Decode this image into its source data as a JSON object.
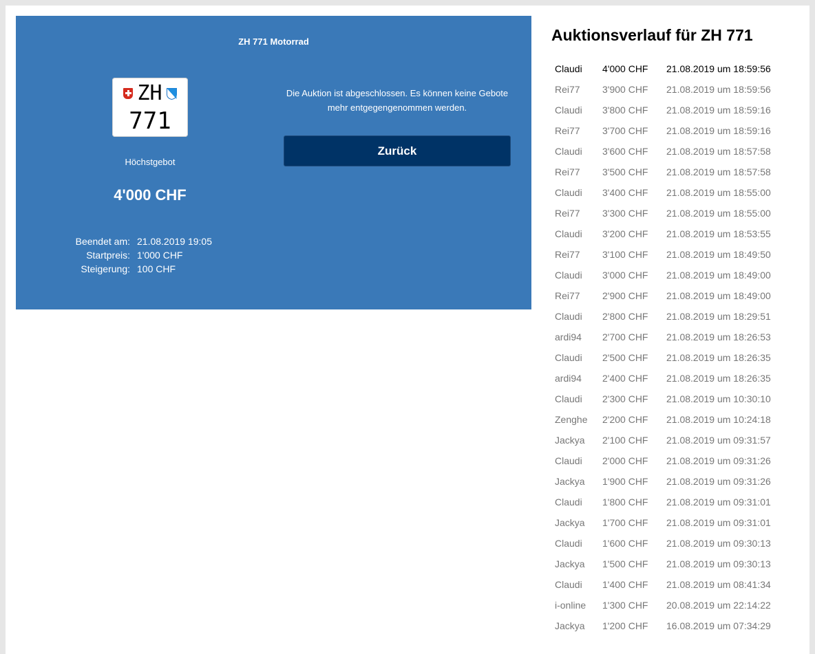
{
  "panel": {
    "title": "ZH 771 Motorrad",
    "plate": {
      "canton": "ZH",
      "number": "771"
    },
    "highest_bid_label": "Höchstgebot",
    "highest_bid_value": "4'000 CHF",
    "info": [
      {
        "label": "Beendet am:",
        "value": "21.08.2019 19:05"
      },
      {
        "label": "Startpreis:",
        "value": "1'000 CHF"
      },
      {
        "label": "Steigerung:",
        "value": "100 CHF"
      }
    ],
    "closed_message": "Die Auktion ist abgeschlossen. Es können keine Gebote mehr entgegengenommen werden.",
    "back_label": "Zurück"
  },
  "history": {
    "title": "Auktionsverlauf für ZH 771",
    "rows": [
      {
        "user": "Claudi",
        "amount": "4'000 CHF",
        "time": "21.08.2019 um 18:59:56"
      },
      {
        "user": "Rei77",
        "amount": "3'900 CHF",
        "time": "21.08.2019 um 18:59:56"
      },
      {
        "user": "Claudi",
        "amount": "3'800 CHF",
        "time": "21.08.2019 um 18:59:16"
      },
      {
        "user": "Rei77",
        "amount": "3'700 CHF",
        "time": "21.08.2019 um 18:59:16"
      },
      {
        "user": "Claudi",
        "amount": "3'600 CHF",
        "time": "21.08.2019 um 18:57:58"
      },
      {
        "user": "Rei77",
        "amount": "3'500 CHF",
        "time": "21.08.2019 um 18:57:58"
      },
      {
        "user": "Claudi",
        "amount": "3'400 CHF",
        "time": "21.08.2019 um 18:55:00"
      },
      {
        "user": "Rei77",
        "amount": "3'300 CHF",
        "time": "21.08.2019 um 18:55:00"
      },
      {
        "user": "Claudi",
        "amount": "3'200 CHF",
        "time": "21.08.2019 um 18:53:55"
      },
      {
        "user": "Rei77",
        "amount": "3'100 CHF",
        "time": "21.08.2019 um 18:49:50"
      },
      {
        "user": "Claudi",
        "amount": "3'000 CHF",
        "time": "21.08.2019 um 18:49:00"
      },
      {
        "user": "Rei77",
        "amount": "2'900 CHF",
        "time": "21.08.2019 um 18:49:00"
      },
      {
        "user": "Claudi",
        "amount": "2'800 CHF",
        "time": "21.08.2019 um 18:29:51"
      },
      {
        "user": "ardi94",
        "amount": "2'700 CHF",
        "time": "21.08.2019 um 18:26:53"
      },
      {
        "user": "Claudi",
        "amount": "2'500 CHF",
        "time": "21.08.2019 um 18:26:35"
      },
      {
        "user": "ardi94",
        "amount": "2'400 CHF",
        "time": "21.08.2019 um 18:26:35"
      },
      {
        "user": "Claudi",
        "amount": "2'300 CHF",
        "time": "21.08.2019 um 10:30:10"
      },
      {
        "user": "Zenghe",
        "amount": "2'200 CHF",
        "time": "21.08.2019 um 10:24:18"
      },
      {
        "user": "Jackya",
        "amount": "2'100 CHF",
        "time": "21.08.2019 um 09:31:57"
      },
      {
        "user": "Claudi",
        "amount": "2'000 CHF",
        "time": "21.08.2019 um 09:31:26"
      },
      {
        "user": "Jackya",
        "amount": "1'900 CHF",
        "time": "21.08.2019 um 09:31:26"
      },
      {
        "user": "Claudi",
        "amount": "1'800 CHF",
        "time": "21.08.2019 um 09:31:01"
      },
      {
        "user": "Jackya",
        "amount": "1'700 CHF",
        "time": "21.08.2019 um 09:31:01"
      },
      {
        "user": "Claudi",
        "amount": "1'600 CHF",
        "time": "21.08.2019 um 09:30:13"
      },
      {
        "user": "Jackya",
        "amount": "1'500 CHF",
        "time": "21.08.2019 um 09:30:13"
      },
      {
        "user": "Claudi",
        "amount": "1'400 CHF",
        "time": "21.08.2019 um 08:41:34"
      },
      {
        "user": "i-online",
        "amount": "1'300 CHF",
        "time": "20.08.2019 um 22:14:22"
      },
      {
        "user": "Jackya",
        "amount": "1'200 CHF",
        "time": "16.08.2019 um 07:34:29"
      }
    ]
  },
  "colors": {
    "panel_bg": "#3a79b8",
    "button_bg": "#003366",
    "history_text": "#777777"
  }
}
